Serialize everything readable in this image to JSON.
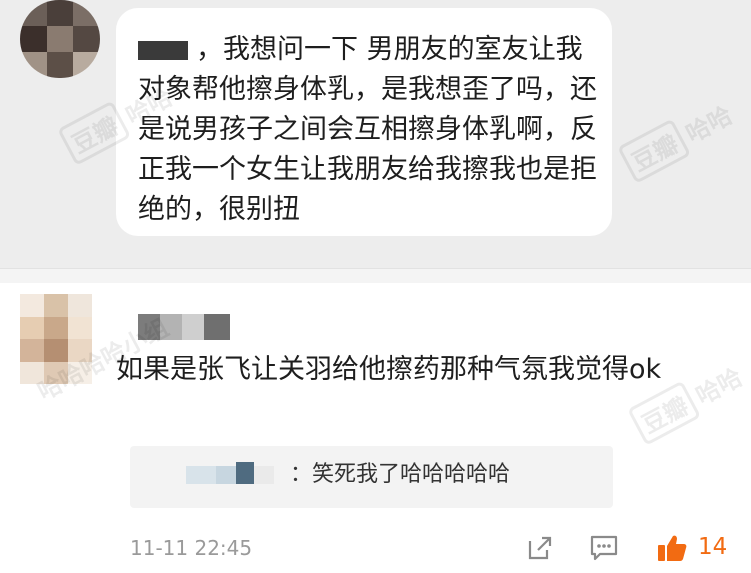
{
  "post": {
    "text": "，我想问一下 男朋友的室友让我对象帮他擦身体乳，是我想歪了吗，还是说男孩子之间会互相擦身体乳啊，反正我一个女生让我朋友给我擦我也是拒绝的，很别扭"
  },
  "comment": {
    "text": "如果是张飞让关羽给他擦药那种气氛我觉得ok",
    "reply_text": "：笑死我了哈哈哈哈哈",
    "timestamp": "11-11 22:45",
    "like_count": "14"
  },
  "watermarks": {
    "brand": "豆瓣",
    "group": "哈哈哈哈小组",
    "suffix": "哈哈"
  },
  "icons": {
    "share": "share-icon",
    "reply": "comment-icon",
    "like": "thumbs-up-icon"
  },
  "colors": {
    "like_accent": "#f26b12",
    "meta_gray": "#9a9a9a"
  }
}
